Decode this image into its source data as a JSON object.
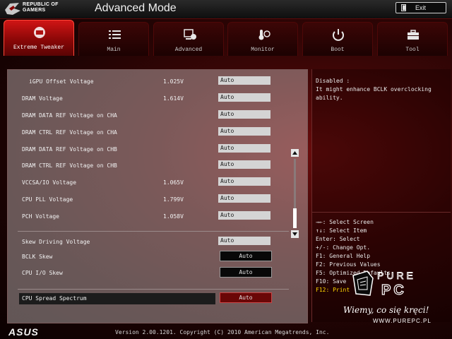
{
  "header": {
    "brand_line1": "REPUBLIC OF",
    "brand_line2": "GAMERS",
    "mode_title": "Advanced Mode",
    "exit_label": "Exit"
  },
  "tabs": [
    {
      "label": "Extreme Tweaker",
      "icon": "tweaker-icon",
      "active": true
    },
    {
      "label": "Main",
      "icon": "list-icon",
      "active": false
    },
    {
      "label": "Advanced",
      "icon": "advanced-icon",
      "active": false
    },
    {
      "label": "Monitor",
      "icon": "thermometer-fan-icon",
      "active": false
    },
    {
      "label": "Boot",
      "icon": "power-icon",
      "active": false
    },
    {
      "label": "Tool",
      "icon": "toolbox-icon",
      "active": false
    }
  ],
  "settings": [
    {
      "label": "iGPU Offset Voltage",
      "value": "1.025V",
      "setting": "Auto"
    },
    {
      "label": "DRAM Voltage",
      "value": "1.614V",
      "setting": "Auto"
    },
    {
      "label": "DRAM DATA REF Voltage on CHA",
      "value": "",
      "setting": "Auto"
    },
    {
      "label": "DRAM CTRL REF Voltage on CHA",
      "value": "",
      "setting": "Auto"
    },
    {
      "label": "DRAM DATA REF Voltage on CHB",
      "value": "",
      "setting": "Auto"
    },
    {
      "label": "DRAM CTRL REF Voltage on CHB",
      "value": "",
      "setting": "Auto"
    },
    {
      "label": "VCCSA/IO Voltage",
      "value": "1.065V",
      "setting": "Auto"
    },
    {
      "label": "CPU PLL Voltage",
      "value": "1.799V",
      "setting": "Auto"
    },
    {
      "label": "PCH Voltage",
      "value": "1.058V",
      "setting": "Auto"
    },
    {
      "label": "Skew Driving Voltage",
      "value": "",
      "setting": "Auto"
    },
    {
      "label": "BCLK Skew",
      "value": "",
      "setting": "Auto"
    },
    {
      "label": "CPU I/O Skew",
      "value": "",
      "setting": "Auto"
    },
    {
      "label": "CPU Spread Spectrum",
      "value": "",
      "setting": "Auto"
    }
  ],
  "help": {
    "lines": [
      "Disabled :",
      "It might enhance BCLK overclocking",
      "ability."
    ]
  },
  "keys": [
    "→←: Select Screen",
    "↑↓: Select Item",
    "Enter: Select",
    "+/-: Change Opt.",
    "F1: General Help",
    "F2: Previous Values",
    "F5: Optimized Defaults",
    "F10: Save",
    "F12: Print"
  ],
  "watermark": {
    "logo": "PURE PC",
    "slogan": "Wiemy, co się kręci!",
    "url": "WWW.PUREPC.PL"
  },
  "footer": {
    "brand": "ASUS",
    "version": "Version 2.00.1201. Copyright (C) 2010 American Megatrends, Inc."
  },
  "colors": {
    "accent_red": "#d01515",
    "highlight_yellow": "#ffd700"
  }
}
